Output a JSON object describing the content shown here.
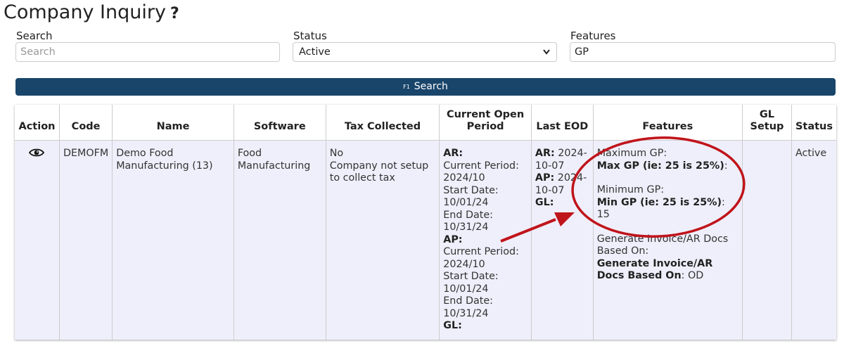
{
  "page": {
    "title": "Company Inquiry",
    "help_icon": "question-icon"
  },
  "filters": {
    "search_label": "Search",
    "search_placeholder": "Search",
    "status_label": "Status",
    "status_value": "Active",
    "features_label": "Features",
    "features_value": "GP"
  },
  "search_button": {
    "key": "F1",
    "label": "Search"
  },
  "table": {
    "headers": [
      "Action",
      "Code",
      "Name",
      "Software",
      "Tax Collected",
      "Current Open Period",
      "Last EOD",
      "Features",
      "GL Setup",
      "Status"
    ],
    "row": {
      "action_icon": "eye-icon",
      "code": "DEMOFM",
      "name": "Demo Food Manufacturing (13)",
      "software": "Food Manufacturing",
      "tax": {
        "value": "No",
        "note": "Company not setup to collect tax"
      },
      "period": {
        "ar_label": "AR:",
        "ar_current": "Current Period: 2024/10",
        "ar_start": "Start Date: 10/01/24",
        "ar_end": "End Date: 10/31/24",
        "ap_label": "AP:",
        "ap_current": "Current Period: 2024/10",
        "ap_start": "Start Date: 10/01/24",
        "ap_end": "End Date: 10/31/24",
        "gl_label": "GL:"
      },
      "last_eod": {
        "ar_label": "AR:",
        "ar_value": "2024-10-07",
        "ap_label": "AP:",
        "ap_value": "2024-10-07",
        "gl_label": "GL:"
      },
      "features": {
        "max_title": "Maximum GP:",
        "max_label": "Max GP (ie: 25 is 25%)",
        "max_value": ":",
        "min_title": "Minimum GP:",
        "min_label": "Min GP (ie: 25 is 25%)",
        "min_value": ": 15",
        "gen_title": "Generate Invoice/AR Docs Based On:",
        "gen_label": "Generate Invoice/AR Docs Based On",
        "gen_value": ": OD"
      },
      "gl_setup": "",
      "status": "Active"
    }
  },
  "colors": {
    "accent": "#19456b",
    "row_bg": "#efeffb",
    "annotation": "#c0141b"
  }
}
